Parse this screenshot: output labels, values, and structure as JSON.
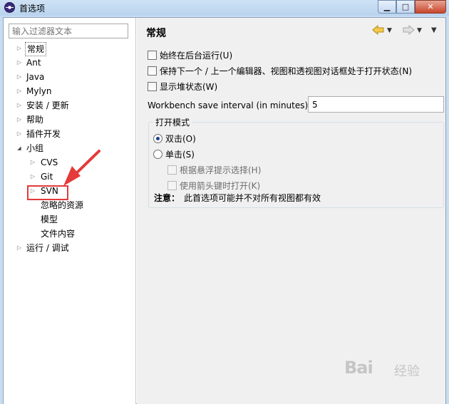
{
  "window": {
    "title": "首选项",
    "controls": [
      "minimize",
      "maximize",
      "close"
    ]
  },
  "sidebar": {
    "filter_placeholder": "输入过滤器文本",
    "tree": [
      {
        "label": "常规",
        "state": "collapsed",
        "selected": true
      },
      {
        "label": "Ant",
        "state": "collapsed"
      },
      {
        "label": "Java",
        "state": "collapsed"
      },
      {
        "label": "Mylyn",
        "state": "collapsed"
      },
      {
        "label": "安装 / 更新",
        "state": "collapsed"
      },
      {
        "label": "帮助",
        "state": "collapsed"
      },
      {
        "label": "插件开发",
        "state": "collapsed"
      },
      {
        "label": "小组",
        "state": "expanded"
      },
      {
        "label": "CVS",
        "state": "collapsed",
        "level": 1
      },
      {
        "label": "Git",
        "state": "collapsed",
        "level": 1
      },
      {
        "label": "SVN",
        "state": "collapsed",
        "level": 1,
        "highlighted": true
      },
      {
        "label": "忽略的资源",
        "state": "leaf",
        "level": 1
      },
      {
        "label": "模型",
        "state": "leaf",
        "level": 1
      },
      {
        "label": "文件内容",
        "state": "leaf",
        "level": 1
      },
      {
        "label": "运行 / 调试",
        "state": "collapsed"
      }
    ],
    "annotation_color": "#e43a3a"
  },
  "main": {
    "title": "常规",
    "toolbar": {
      "back_icon": "back-arrow-icon",
      "forward_icon": "forward-arrow-icon",
      "menu_icon": "view-menu-icon"
    },
    "options": [
      {
        "label": "始终在后台运行(U)",
        "checked": false
      },
      {
        "label": "保持下一个 / 上一个编辑器、视图和透视图对话框处于打开状态(N)",
        "checked": false
      },
      {
        "label": "显示堆状态(W)",
        "checked": false
      }
    ],
    "interval": {
      "label": "Workbench save interval (in minutes):",
      "value": "5"
    },
    "open_mode": {
      "title": "打开模式",
      "double_click": {
        "label": "双击(O)",
        "checked": true
      },
      "single_click": {
        "label": "单击(S)",
        "checked": false
      },
      "hover_select": {
        "label": "根据悬浮提示选择(H)",
        "checked": false,
        "enabled": false
      },
      "arrow_open": {
        "label": "使用箭头键时打开(K)",
        "checked": false,
        "enabled": false
      },
      "note_label": "注意：",
      "note_text": "此首选项可能并不对所有视图都有效"
    }
  },
  "watermark": {
    "brand": "Bai",
    "suffix": "经验"
  }
}
